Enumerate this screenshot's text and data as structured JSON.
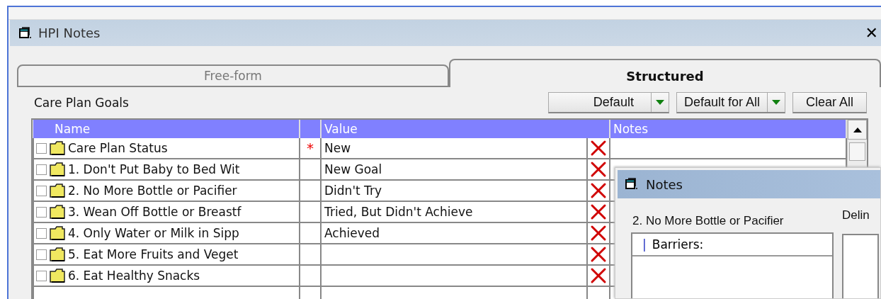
{
  "window": {
    "title": "HPI Notes",
    "close": "✕"
  },
  "tabs": [
    {
      "label": "Free-form",
      "selected": false
    },
    {
      "label": "Structured",
      "selected": true
    }
  ],
  "section_label": "Care Plan Goals",
  "buttons": [
    {
      "label": "Default",
      "kind": "dropdown"
    },
    {
      "label": "Default for All",
      "kind": "dropdown"
    },
    {
      "label": "Clear All",
      "kind": "plain"
    }
  ],
  "table": {
    "columns": [
      "Name",
      "Value",
      "Notes"
    ],
    "rows": [
      {
        "name": "Care Plan Status",
        "checked": false,
        "marker": "*",
        "value": "New"
      },
      {
        "name": "1. Don't Put Baby to Bed Wit",
        "checked": false,
        "value": "New Goal"
      },
      {
        "name": "2. No More Bottle or Pacifier",
        "checked": false,
        "value": "Didn't Try"
      },
      {
        "name": "3. Wean Off Bottle or Breastf",
        "checked": false,
        "value": "Tried, But Didn't Achieve"
      },
      {
        "name": "4. Only Water or Milk in Sipp",
        "checked": false,
        "value": "Achieved"
      },
      {
        "name": "5. Eat More Fruits and Veget",
        "checked": false
      },
      {
        "name": "6. Eat Healthy Snacks",
        "checked": false
      }
    ]
  },
  "notes_dialog": {
    "title": "Notes",
    "goal_label": "2. No More Bottle or Pacifier",
    "list_marker": "|",
    "list_header": "Barriers:",
    "side_label": "Delin"
  }
}
